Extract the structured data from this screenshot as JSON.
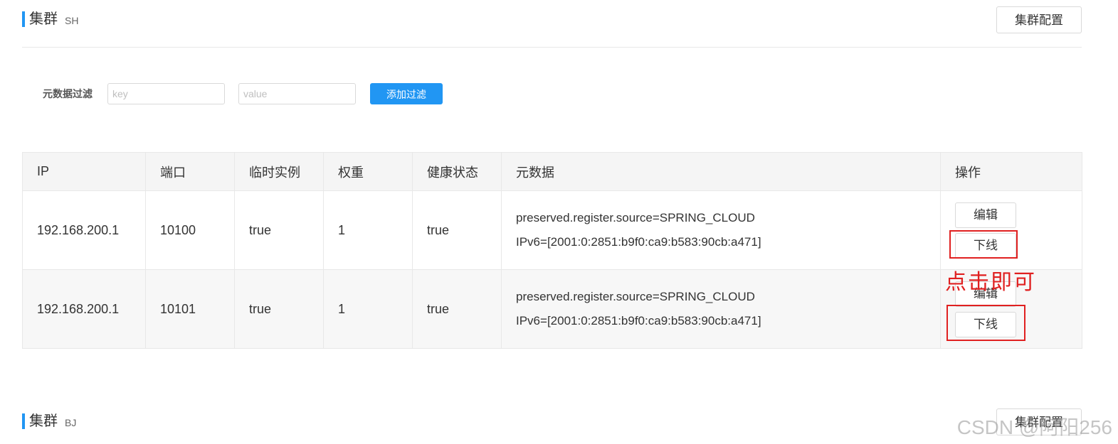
{
  "clusters": [
    {
      "title": "集群",
      "name": "SH",
      "config_label": "集群配置"
    },
    {
      "title": "集群",
      "name": "BJ",
      "config_label": "集群配置"
    }
  ],
  "filter": {
    "label": "元数据过滤",
    "key_placeholder": "key",
    "value_placeholder": "value",
    "add_label": "添加过滤"
  },
  "table": {
    "headers": [
      "IP",
      "端口",
      "临时实例",
      "权重",
      "健康状态",
      "元数据",
      "操作"
    ],
    "rows": [
      {
        "ip": "192.168.200.1",
        "port": "10100",
        "ephemeral": "true",
        "weight": "1",
        "healthy": "true",
        "metadata": [
          "preserved.register.source=SPRING_CLOUD",
          "IPv6=[2001:0:2851:b9f0:ca9:b583:90cb:a471]"
        ],
        "edit_label": "编辑",
        "offline_label": "下线"
      },
      {
        "ip": "192.168.200.1",
        "port": "10101",
        "ephemeral": "true",
        "weight": "1",
        "healthy": "true",
        "metadata": [
          "preserved.register.source=SPRING_CLOUD",
          "IPv6=[2001:0:2851:b9f0:ca9:b583:90cb:a471]"
        ],
        "edit_label": "编辑",
        "offline_label": "下线"
      }
    ]
  },
  "annotation": "点击即可",
  "watermark": "CSDN @阿阳256",
  "colors": {
    "accent": "#2196f3",
    "annotation": "#e02020"
  }
}
